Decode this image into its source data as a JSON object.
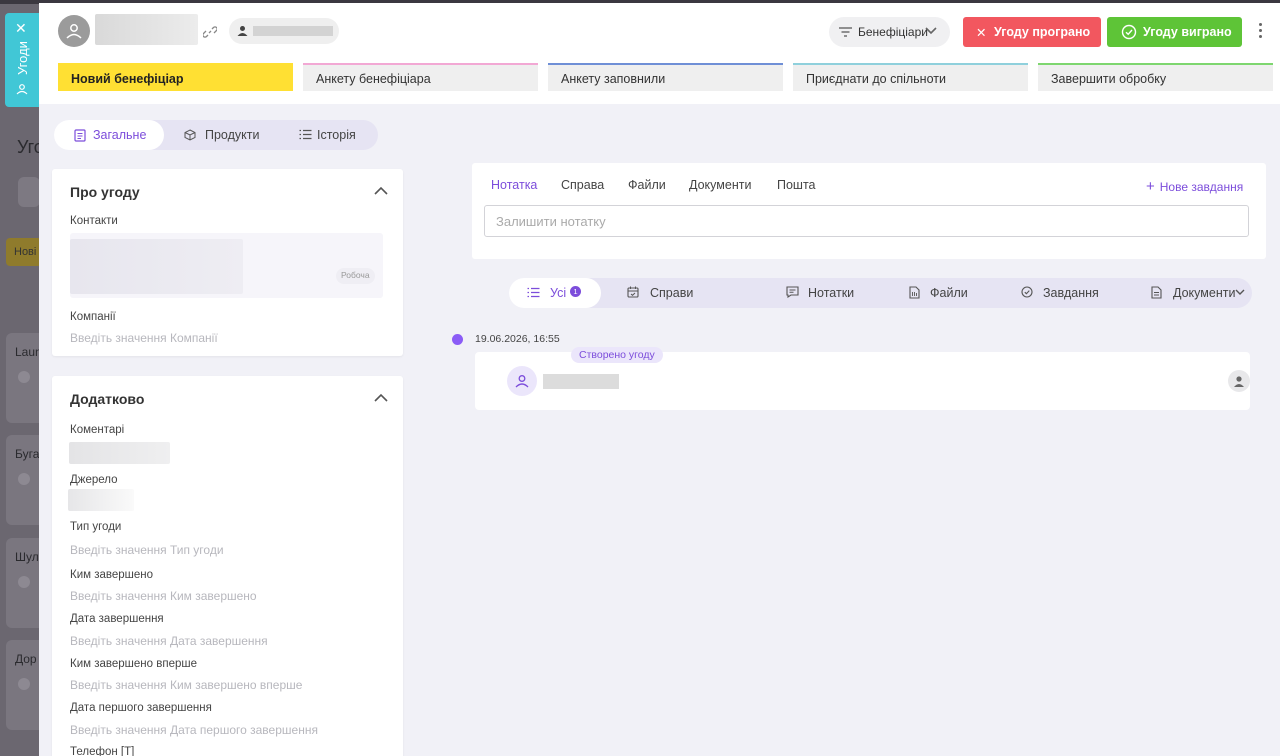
{
  "side_tab": {
    "label": "Угоди"
  },
  "background": {
    "title": "Уго",
    "chip": "Нові",
    "cards": [
      "Laun",
      "Буга",
      "Шул",
      "Дор"
    ]
  },
  "header": {
    "beneficiaries_label": "Бенефіціари",
    "lost_label": "Угоду програно",
    "won_label": "Угоду виграно"
  },
  "stages": [
    {
      "label": "Новий бенефіціар",
      "color": "#ffe033",
      "active": true
    },
    {
      "label": "Анкету бенефіціара",
      "color": "#f2a8d4"
    },
    {
      "label": "Анкету заповнили",
      "color": "#6f8fd6"
    },
    {
      "label": "Приєднати до спільноти",
      "color": "#8fd0dc"
    },
    {
      "label": "Завершити обробку",
      "color": "#7ed66f"
    }
  ],
  "tabs": [
    {
      "label": "Загальне",
      "active": true
    },
    {
      "label": "Продукти"
    },
    {
      "label": "Історія"
    }
  ],
  "about": {
    "title": "Про угоду",
    "contacts_label": "Контакти",
    "contact_tag": "Робоча",
    "companies_label": "Компанії",
    "companies_placeholder": "Введіть значення Компанії"
  },
  "extra": {
    "title": "Додатково",
    "fields": [
      {
        "label": "Коментарі"
      },
      {
        "label": "Джерело"
      },
      {
        "label": "Тип угоди",
        "placeholder": "Введіть значення Тип угоди"
      },
      {
        "label": "Ким завершено",
        "placeholder": "Введіть значення Ким завершено"
      },
      {
        "label": "Дата завершення",
        "placeholder": "Введіть значення Дата завершення"
      },
      {
        "label": "Ким завершено вперше",
        "placeholder": "Введіть значення Ким завершено вперше"
      },
      {
        "label": "Дата першого завершення",
        "placeholder": "Введіть значення Дата першого завершення"
      },
      {
        "label": "Телефон [Т]"
      }
    ]
  },
  "note_panel": {
    "tabs": [
      "Нотатка",
      "Справа",
      "Файли",
      "Документи",
      "Пошта"
    ],
    "new_task": "Нове завдання",
    "input_placeholder": "Залишити нотатку"
  },
  "filters": [
    {
      "label": "Усі",
      "count": "1",
      "active": true
    },
    {
      "label": "Справи"
    },
    {
      "label": "Нотатки"
    },
    {
      "label": "Файли"
    },
    {
      "label": "Завдання"
    },
    {
      "label": "Документи"
    }
  ],
  "timeline": {
    "date": "19.06.2026, 16:55",
    "event_tag": "Створено угоду"
  },
  "colors": {
    "accent": "#7c4ddb",
    "lost": "#f2575f",
    "won": "#5ec437",
    "side_tab": "#41c7d6"
  }
}
